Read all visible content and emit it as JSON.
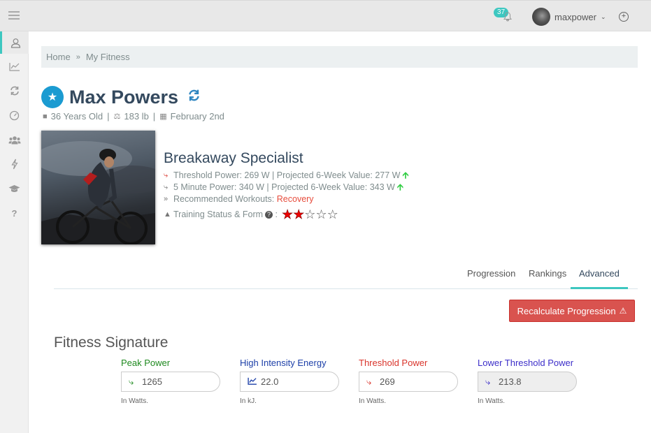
{
  "topbar": {
    "notification_count": "37",
    "username": "maxpower"
  },
  "breadcrumb": {
    "home": "Home",
    "current": "My Fitness"
  },
  "profile": {
    "name": "Max Powers",
    "age": "36 Years Old",
    "weight": "183 lb",
    "birthday": "February 2nd",
    "rider_type": "Breakaway Specialist",
    "threshold_line": "Threshold Power: 269 W | Projected 6-Week Value: 277 W",
    "five_min_line": "5 Minute Power: 340 W | Projected 6-Week Value: 343 W",
    "workouts_label": "Recommended Workouts: ",
    "workouts_value": "Recovery",
    "training_label": "Training Status & Form",
    "training_stars": 2,
    "training_stars_max": 5
  },
  "tabs": [
    {
      "label": "Progression",
      "active": false
    },
    {
      "label": "Rankings",
      "active": false
    },
    {
      "label": "Advanced",
      "active": true
    }
  ],
  "recalculate_label": "Recalculate Progression",
  "fitness_signature": {
    "title": "Fitness Signature",
    "fields": [
      {
        "label": "Peak Power",
        "value": "1265",
        "hint": "In Watts.",
        "color": "#1f8a1f"
      },
      {
        "label": "High Intensity Energy",
        "value": "22.0",
        "hint": "In kJ.",
        "color": "#1c3fa8"
      },
      {
        "label": "Threshold Power",
        "value": "269",
        "hint": "In Watts.",
        "color": "#d9342b"
      },
      {
        "label": "Lower Threshold Power",
        "value": "213.8",
        "hint": "In Watts.",
        "color": "#3c2ec9"
      }
    ]
  },
  "icons": {
    "sidebar": [
      "user-icon",
      "chart-line-icon",
      "refresh-icon",
      "gauge-icon",
      "users-icon",
      "bolt-icon",
      "graduation-cap-icon",
      "question-icon"
    ]
  }
}
